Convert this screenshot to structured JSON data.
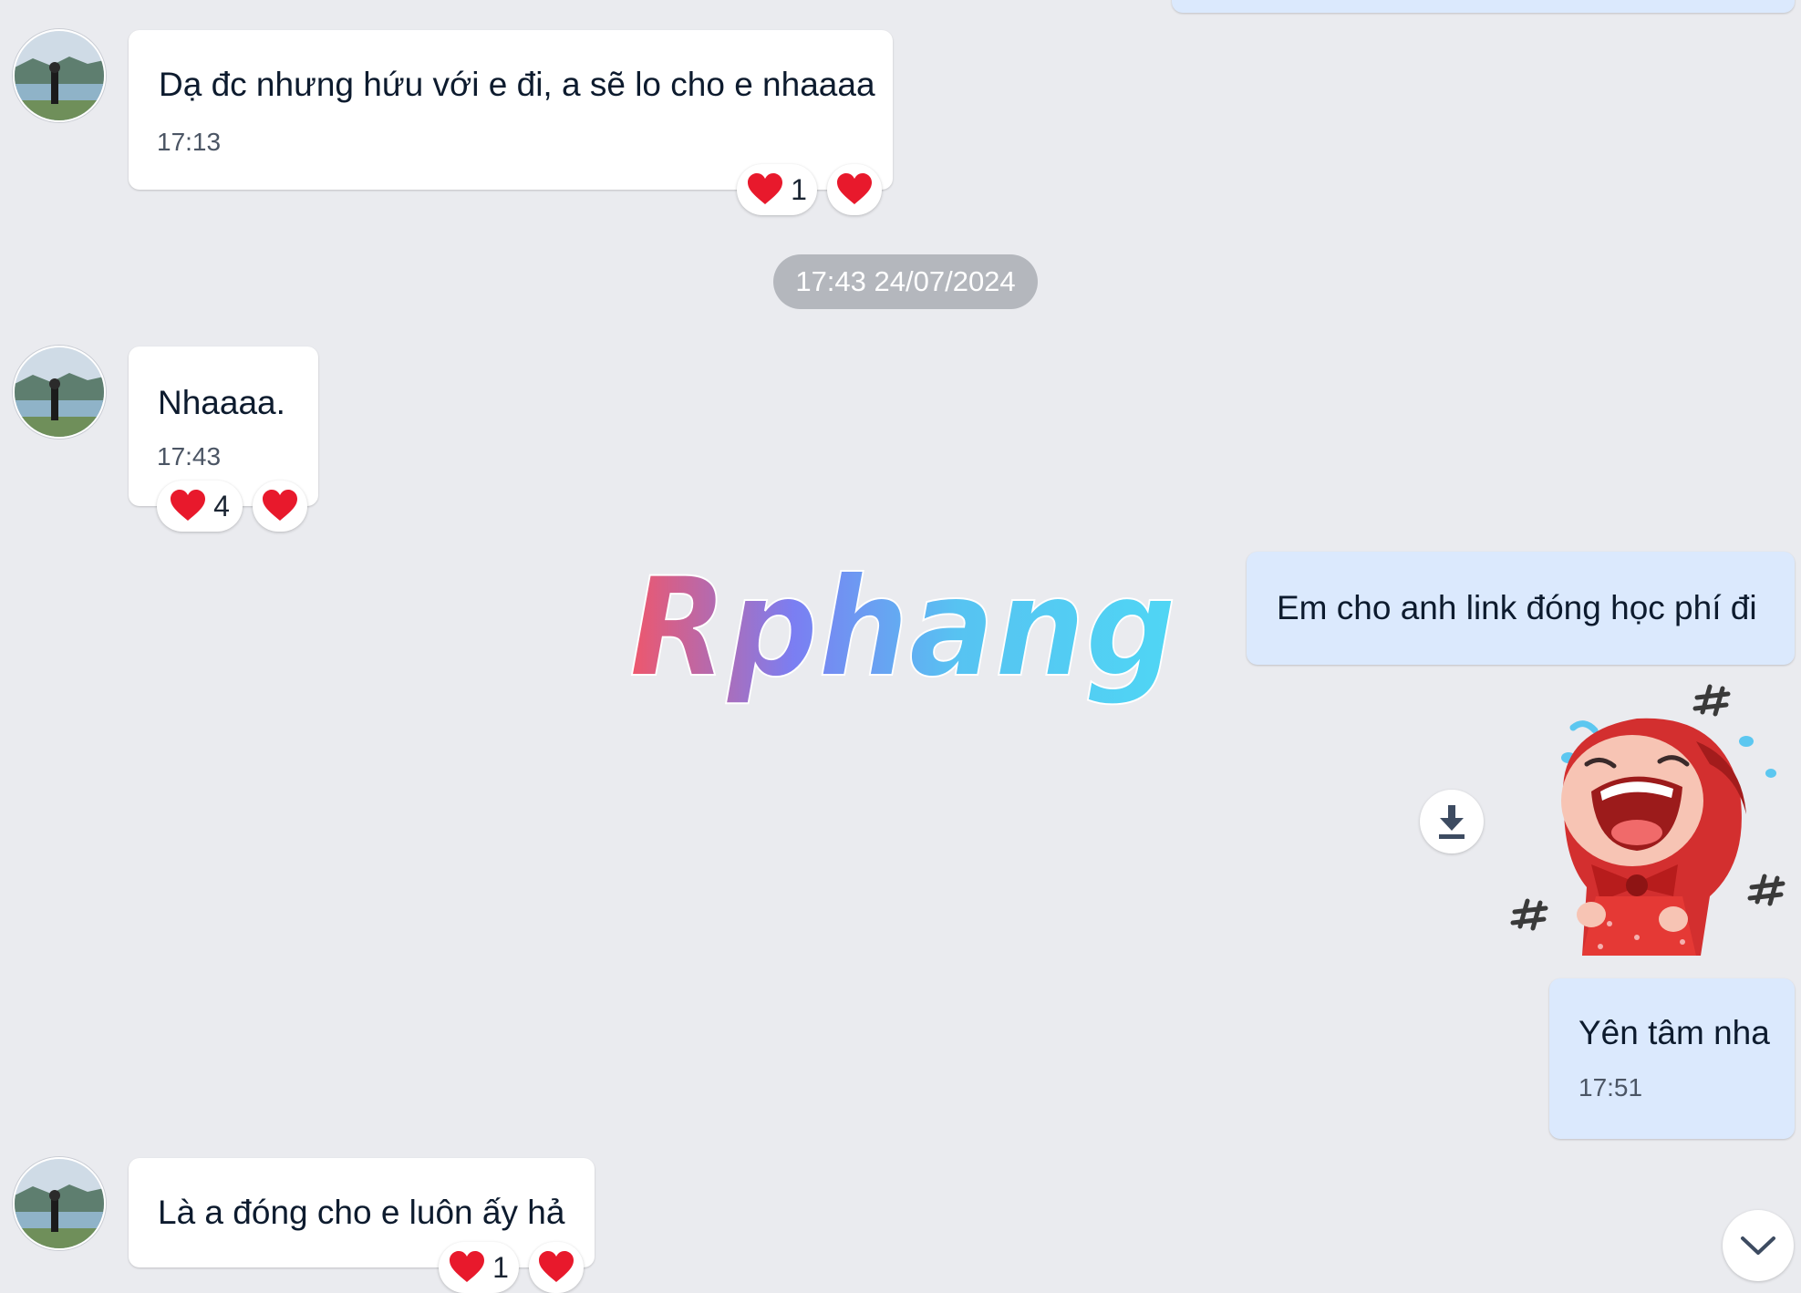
{
  "colors": {
    "background": "#eaebef",
    "incoming_bubble": "#ffffff",
    "outgoing_bubble": "#dbe9fd",
    "heart": "#e8192c",
    "date_pill": "#b4b7bd"
  },
  "messages": [
    {
      "text": "Dạ đc nhưng hứu với e đi, a sẽ lo cho e nhaaaa",
      "time": "17:13",
      "reactions": [
        {
          "icon": "heart-icon",
          "count": "1"
        },
        {
          "icon": "heart-icon"
        }
      ]
    },
    {
      "text": "Nhaaaa.",
      "time": "17:43",
      "reactions": [
        {
          "icon": "heart-icon",
          "count": "4"
        },
        {
          "icon": "heart-icon"
        }
      ]
    },
    {
      "text": "Em cho anh link đóng học phí đi"
    },
    {
      "sticker": "crying-red-hood-girl-sticker"
    },
    {
      "text": "Yên tâm nha",
      "time": "17:51"
    },
    {
      "text": "Là a đóng cho e luôn ấy hả",
      "reactions": [
        {
          "icon": "heart-icon",
          "count": "1"
        },
        {
          "icon": "heart-icon"
        }
      ]
    }
  ],
  "date_divider": "17:43 24/07/2024",
  "watermark": {
    "text": "Rphang"
  },
  "icons": {
    "download": "download-icon",
    "scroll_down": "chevron-down-icon",
    "reaction": "heart-icon"
  }
}
